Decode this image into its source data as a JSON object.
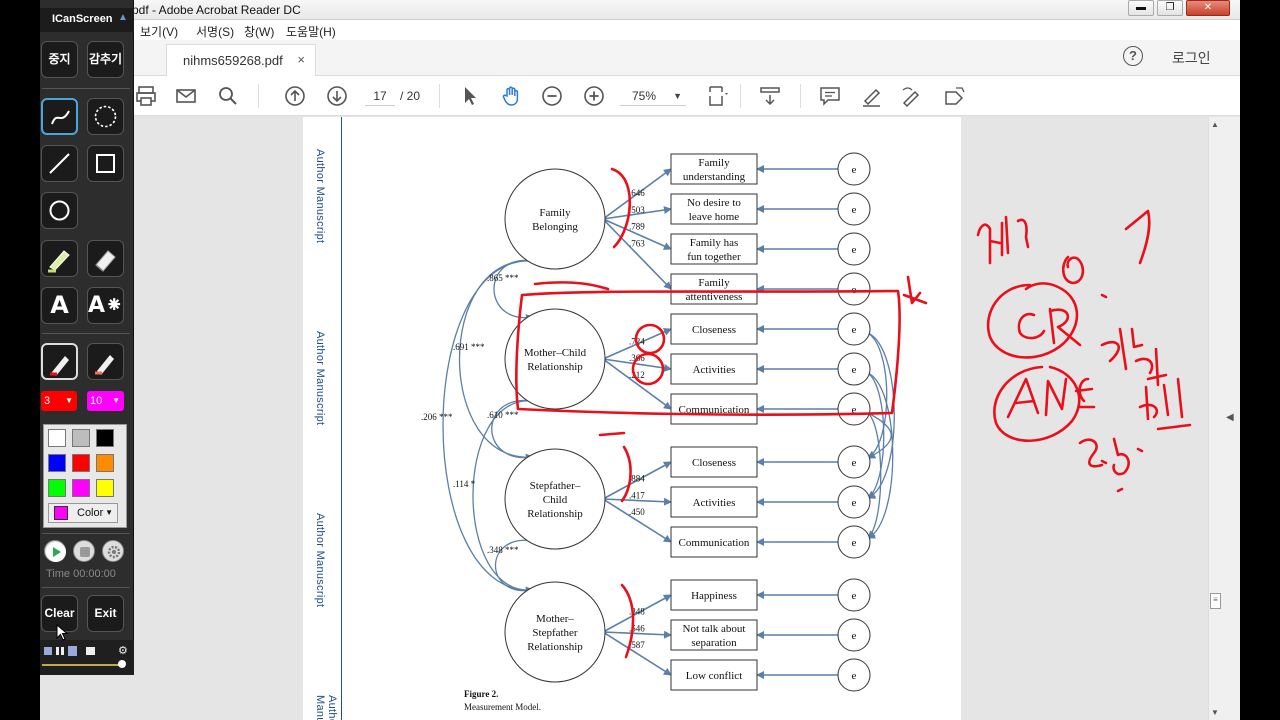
{
  "window": {
    "title": "nihms659268.pdf - Adobe Acrobat Reader DC",
    "title_visible": "pdf - Adobe Acrobat Reader DC",
    "min": "▬",
    "max": "❐",
    "close": "✕"
  },
  "menu": [
    "보기(V)",
    "서명(S)",
    "창(W)",
    "도움말(H)"
  ],
  "tab": {
    "name": "nihms659268.pdf",
    "close": "×"
  },
  "account": {
    "login": "로그인",
    "help": "?"
  },
  "toolbar": {
    "page_current": "17",
    "page_total": "/ 20",
    "zoom": "75%"
  },
  "document": {
    "side_label": "Author Manuscript",
    "figure_label": "Figure 2.",
    "figure_caption": "Measurement Model.",
    "latents": [
      {
        "label": [
          "Family",
          "Belonging"
        ]
      },
      {
        "label": [
          "Mother–Child",
          "Relationship"
        ]
      },
      {
        "label": [
          "Stepfather–",
          "Child",
          "Relationship"
        ]
      },
      {
        "label": [
          "Mother–",
          "Stepfather",
          "Relationship"
        ]
      }
    ],
    "indicators": [
      [
        "Family",
        "understanding"
      ],
      [
        "No desire to",
        "leave home"
      ],
      [
        "Family has",
        "fun together"
      ],
      [
        "Family",
        "attentiveness"
      ],
      [
        "Closeness"
      ],
      [
        "Activities"
      ],
      [
        "Communication"
      ],
      [
        "Closeness"
      ],
      [
        "Activities"
      ],
      [
        "Communication"
      ],
      [
        "Happiness"
      ],
      [
        "Not talk about",
        "separation"
      ],
      [
        "Low conflict"
      ]
    ],
    "error_label": "e",
    "loadings": [
      ".646",
      ".503",
      ".789",
      ".763",
      ".724",
      ".366",
      ".212",
      ".884",
      ".417",
      ".450",
      ".848",
      ".546",
      ".587"
    ],
    "correlations": [
      ".865 ***",
      ".691 ***",
      ".206 ***",
      ".610 ***",
      ".114 *",
      ".348 ***"
    ]
  },
  "annotation_colors": {
    "pen": "#e8101a"
  },
  "ican": {
    "title": "ICanScreen",
    "stop": "중지",
    "hide": "감추기",
    "size_value": "3",
    "opacity_value": "10",
    "color_label": "Color",
    "time": "Time 00:00:00",
    "clear": "Clear",
    "exit": "Exit",
    "palette": [
      "#ffffff",
      "#bdbdbd",
      "#000000",
      "#0000ff",
      "#ff0000",
      "#ff8c00",
      "#00ff00",
      "#ff00ff",
      "#ffff00"
    ]
  }
}
